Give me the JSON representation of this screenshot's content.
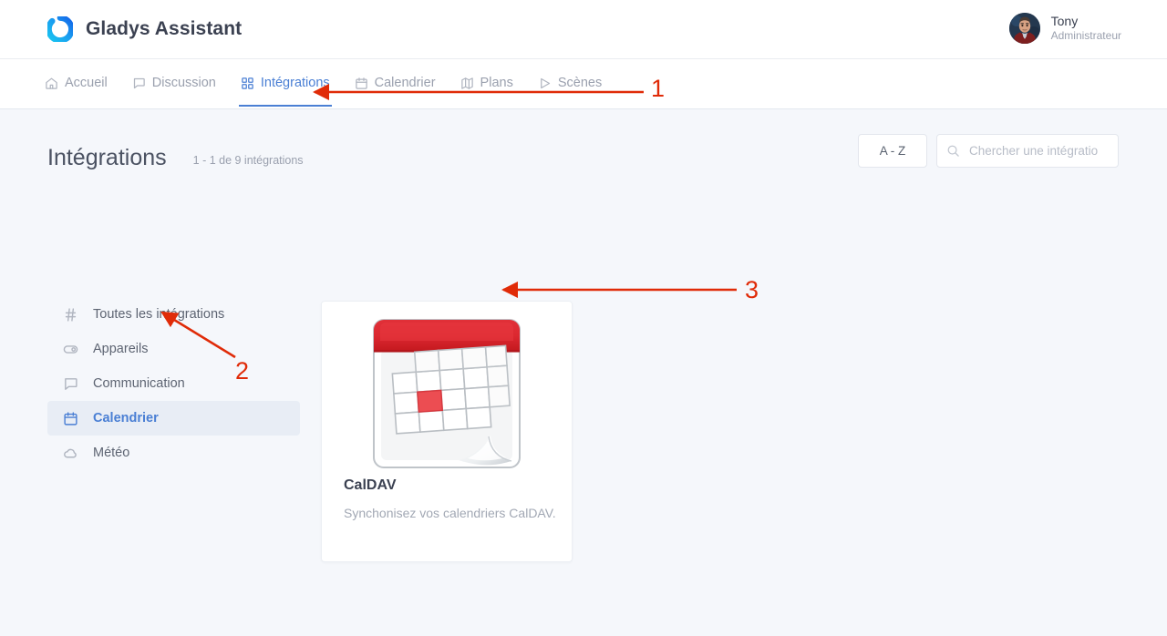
{
  "header": {
    "logo_icon": "gladys-logo-ring",
    "brand_title": "Gladys Assistant",
    "user": {
      "name": "Tony",
      "role": "Administrateur",
      "avatar_icon": "user-avatar-photo"
    }
  },
  "nav": {
    "items": [
      {
        "label": "Accueil",
        "icon": "home-icon",
        "active": false
      },
      {
        "label": "Discussion",
        "icon": "chat-icon",
        "active": false
      },
      {
        "label": "Intégrations",
        "icon": "grid-icon",
        "active": true
      },
      {
        "label": "Calendrier",
        "icon": "calendar-icon",
        "active": false
      },
      {
        "label": "Plans",
        "icon": "map-icon",
        "active": false
      },
      {
        "label": "Scènes",
        "icon": "play-icon",
        "active": false
      }
    ]
  },
  "page": {
    "title": "Intégrations",
    "subtitle": "1 - 1 de 9 intégrations",
    "sort_button_label": "A - Z",
    "search_placeholder": "Chercher une intégratio",
    "search_value": "",
    "search_icon": "search-icon"
  },
  "sidebar": {
    "items": [
      {
        "label": "Toutes les intégrations",
        "icon": "hash-icon",
        "active": false
      },
      {
        "label": "Appareils",
        "icon": "toggle-icon",
        "active": false
      },
      {
        "label": "Communication",
        "icon": "chat-icon",
        "active": false
      },
      {
        "label": "Calendrier",
        "icon": "calendar-icon",
        "active": true
      },
      {
        "label": "Météo",
        "icon": "cloud-icon",
        "active": false
      }
    ]
  },
  "cards": [
    {
      "title": "CalDAV",
      "description": "Synchonisez vos calendriers CalDAV.",
      "image_icon": "calendar-illustration"
    }
  ],
  "annotations": [
    {
      "number": "1",
      "target": "nav-item-integrations",
      "direction": "left"
    },
    {
      "number": "2",
      "target": "sidebar-item-calendrier",
      "direction": "up-left"
    },
    {
      "number": "3",
      "target": "card-caldav-image",
      "direction": "left"
    }
  ],
  "colors": {
    "accent_blue": "#4a7fd4",
    "annotation_red": "#e02b08",
    "calendar_red": "#d9232a",
    "page_background": "#f5f7fb",
    "sidebar_active_bg": "#e8edf5"
  }
}
